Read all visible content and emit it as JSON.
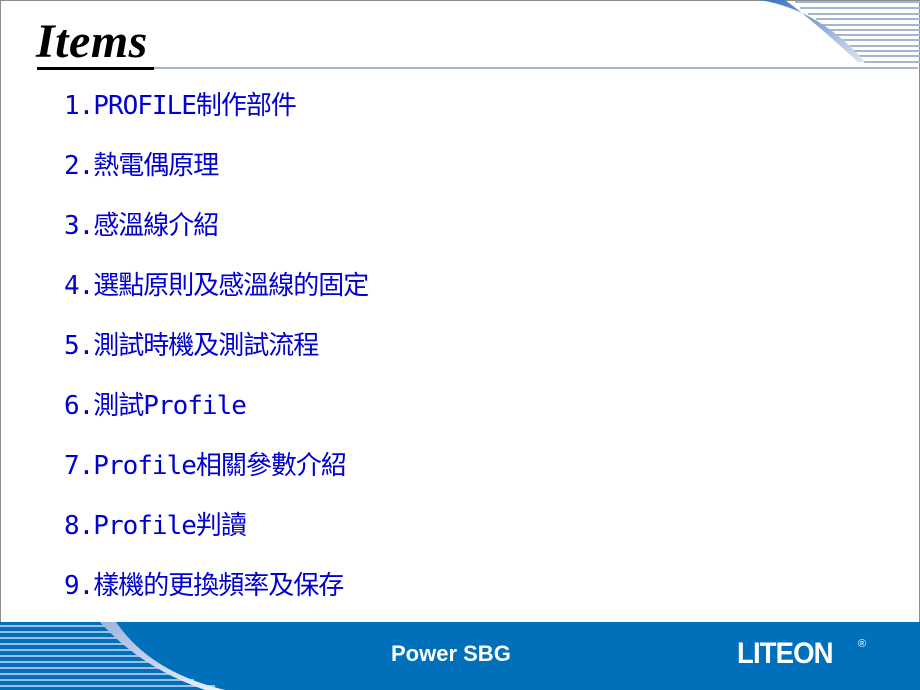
{
  "slide": {
    "title": "Items",
    "items": [
      "1.PROFILE制作部件",
      "2.熱電偶原理",
      "3.感溫線介紹",
      "4.選點原則及感溫線的固定",
      "5.測試時機及測試流程",
      "6.測試Profile",
      "7.Profile相關參數介紹",
      "8.Profile判讀",
      "9.樣機的更換頻率及保存"
    ]
  },
  "footer": {
    "label": "Power SBG",
    "logo_text": "LITEON",
    "logo_mark": "®"
  },
  "colors": {
    "item_text": "#0000d0",
    "footer_bg": "#0070bb",
    "accent_stripe": "#a9b8cf"
  }
}
